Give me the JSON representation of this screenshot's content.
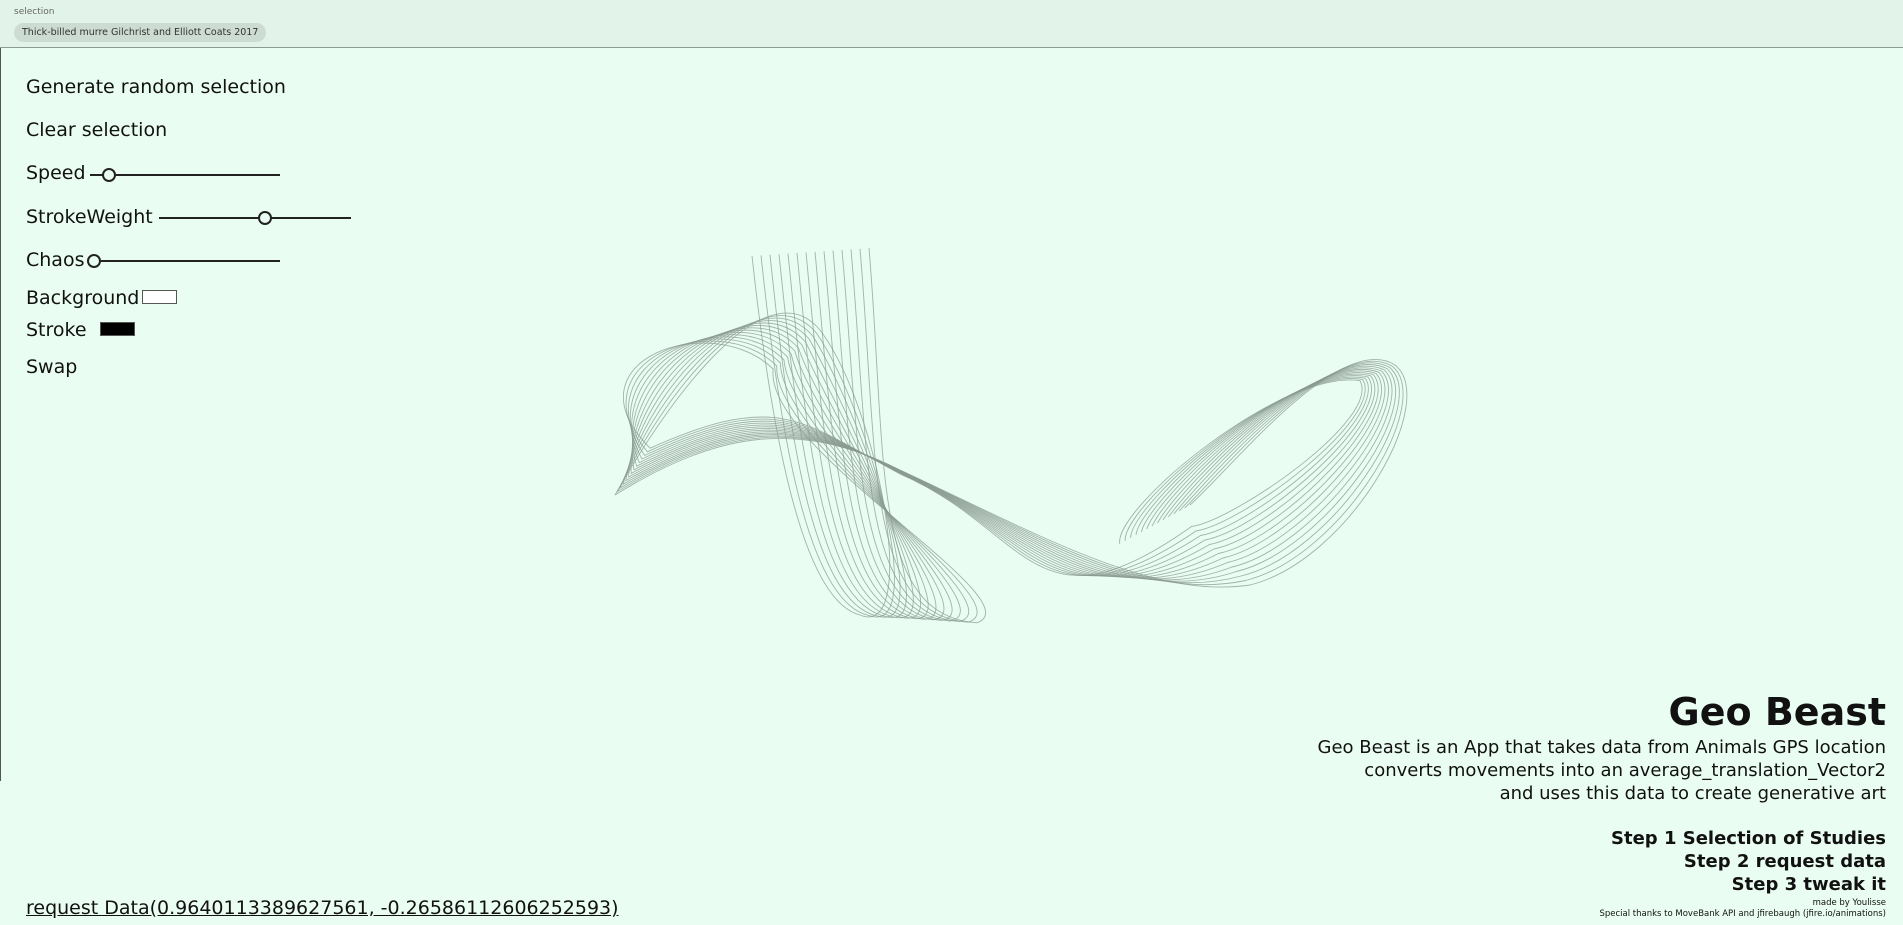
{
  "header": {
    "selection_label": "selection",
    "selected_study": "Thick-billed murre Gilchrist and Elliott Coats 2017"
  },
  "controls": {
    "generate_label": "Generate random selection",
    "clear_label": "Clear selection",
    "speed": {
      "label": "Speed",
      "value": 0.1
    },
    "strokeweight": {
      "label": "StrokeWeight",
      "value": 0.55
    },
    "chaos": {
      "label": "Chaos",
      "value": 0.0
    },
    "background": {
      "label": "Background",
      "color": "#ffffff"
    },
    "stroke": {
      "label": "Stroke",
      "color": "#000000"
    },
    "swap_label": "Swap"
  },
  "info": {
    "title": "Geo Beast",
    "description": [
      "Geo Beast is an App that takes data from Animals GPS location",
      "converts movements into an average_translation_Vector2",
      "and uses this data to create generative art"
    ],
    "steps": [
      "Step 1 Selection of Studies",
      "Step 2 request data",
      "Step 3 tweak it"
    ],
    "credit": "made by Youlisse",
    "thanks": "Special thanks to MoveBank API and jfirebaugh (jfire.io/animations)"
  },
  "request_link": "request Data(0.9640113389627561, -0.26586112606252593)",
  "colors": {
    "page_background": "#eafdf2",
    "topbar_background": "#e2f4e9",
    "art_stroke": "#8a9a90"
  }
}
